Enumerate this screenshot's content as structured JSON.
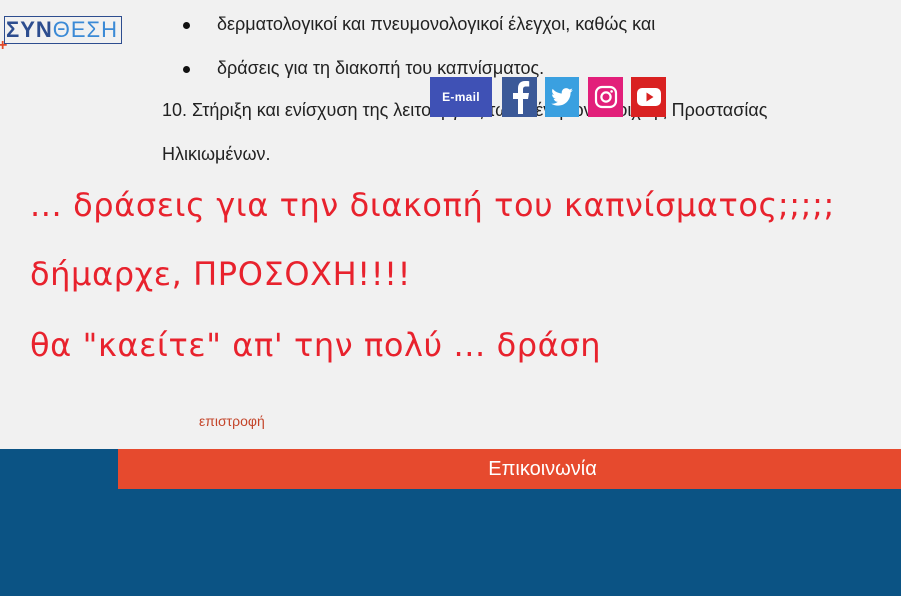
{
  "logo": {
    "part1": "ΣΥΝ",
    "part2": "ΘΕΣΗ",
    "plus": "+"
  },
  "content": {
    "bullets": [
      "δερματολογικοί και πνευμονολογικοί έλεγχοι,   καθώς και",
      "δράσεις για τη διακοπή του καπνίσματος."
    ],
    "numbered_item": {
      "line1": "10.   Στήριξη και ενίσχυση της λειτουργίας των Κέντρων Ανοιχτής Προστασίας",
      "line2": "Ηλικιωμένων."
    },
    "comment_lines": [
      "... δράσεις για την διακοπή του καπνίσματος;;;;;",
      " δήμαρχε, ΠΡΟΣΟΧΗ!!!!",
      "θα \"καείτε\" απ' την πολύ ... δράση"
    ],
    "back_link": "επιστροφή"
  },
  "footer": {
    "contact_title": "Επικοινωνία",
    "email_label": "E-mail",
    "social_icons": [
      "facebook-icon",
      "twitter-icon",
      "instagram-icon",
      "youtube-icon"
    ]
  },
  "colors": {
    "accent_red": "#e8222d",
    "footer_blue": "#0b5384",
    "contact_orange": "#e64a2e"
  }
}
